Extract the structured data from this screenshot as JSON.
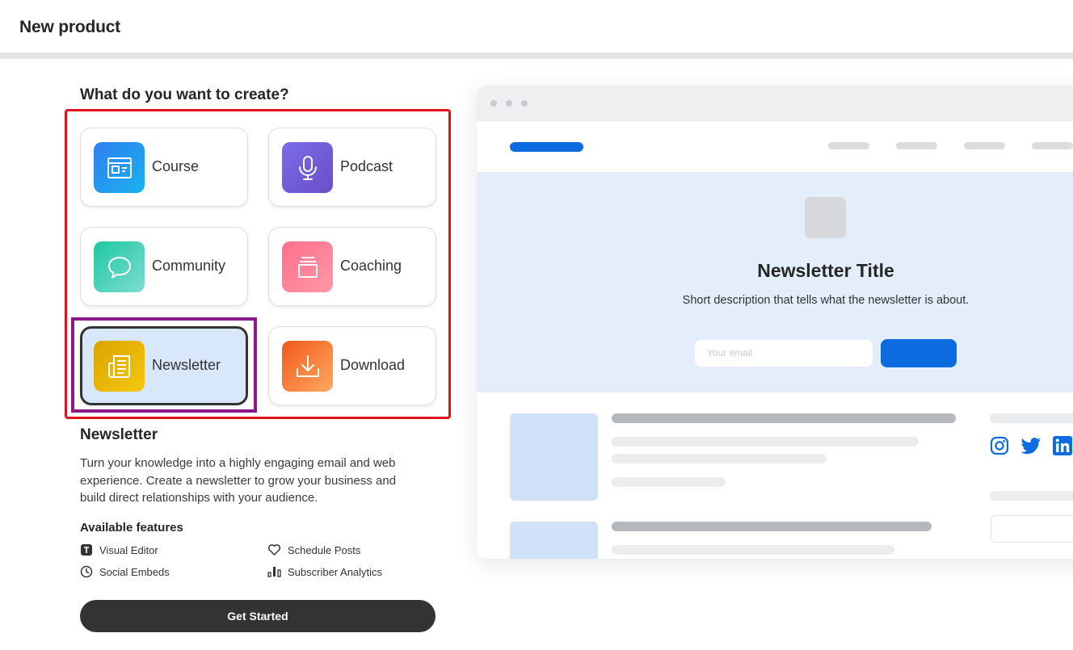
{
  "header": {
    "title": "New product"
  },
  "picker": {
    "question": "What do you want to create?",
    "options": [
      {
        "label": "Course",
        "icon": "course-icon"
      },
      {
        "label": "Podcast",
        "icon": "microphone-icon"
      },
      {
        "label": "Community",
        "icon": "chat-bubble-icon"
      },
      {
        "label": "Coaching",
        "icon": "coaching-icon"
      },
      {
        "label": "Newsletter",
        "icon": "newspaper-icon",
        "selected": true
      },
      {
        "label": "Download",
        "icon": "download-icon"
      }
    ]
  },
  "details": {
    "title": "Newsletter",
    "description": "Turn your knowledge into a highly engaging email and web experience. Create a newsletter to grow your business and build direct relationships with your audience.",
    "features_title": "Available features",
    "features": [
      {
        "label": "Visual Editor",
        "icon": "text-editor-icon"
      },
      {
        "label": "Schedule Posts",
        "icon": "heart-icon"
      },
      {
        "label": "Social Embeds",
        "icon": "clock-icon"
      },
      {
        "label": "Subscriber Analytics",
        "icon": "bar-chart-icon"
      }
    ],
    "cta": "Get Started"
  },
  "preview": {
    "title": "Newsletter Title",
    "subtitle": "Short description that tells what the newsletter is about.",
    "email_placeholder": "Your email",
    "social_icons": [
      "instagram-icon",
      "twitter-icon",
      "linkedin-icon"
    ]
  },
  "colors": {
    "selection_outline": "#8a1a8a",
    "group_outline": "#e0101c",
    "primary_blue": "#0b6bdf",
    "cta_background": "#333333",
    "hero_background": "#e3eefa"
  }
}
